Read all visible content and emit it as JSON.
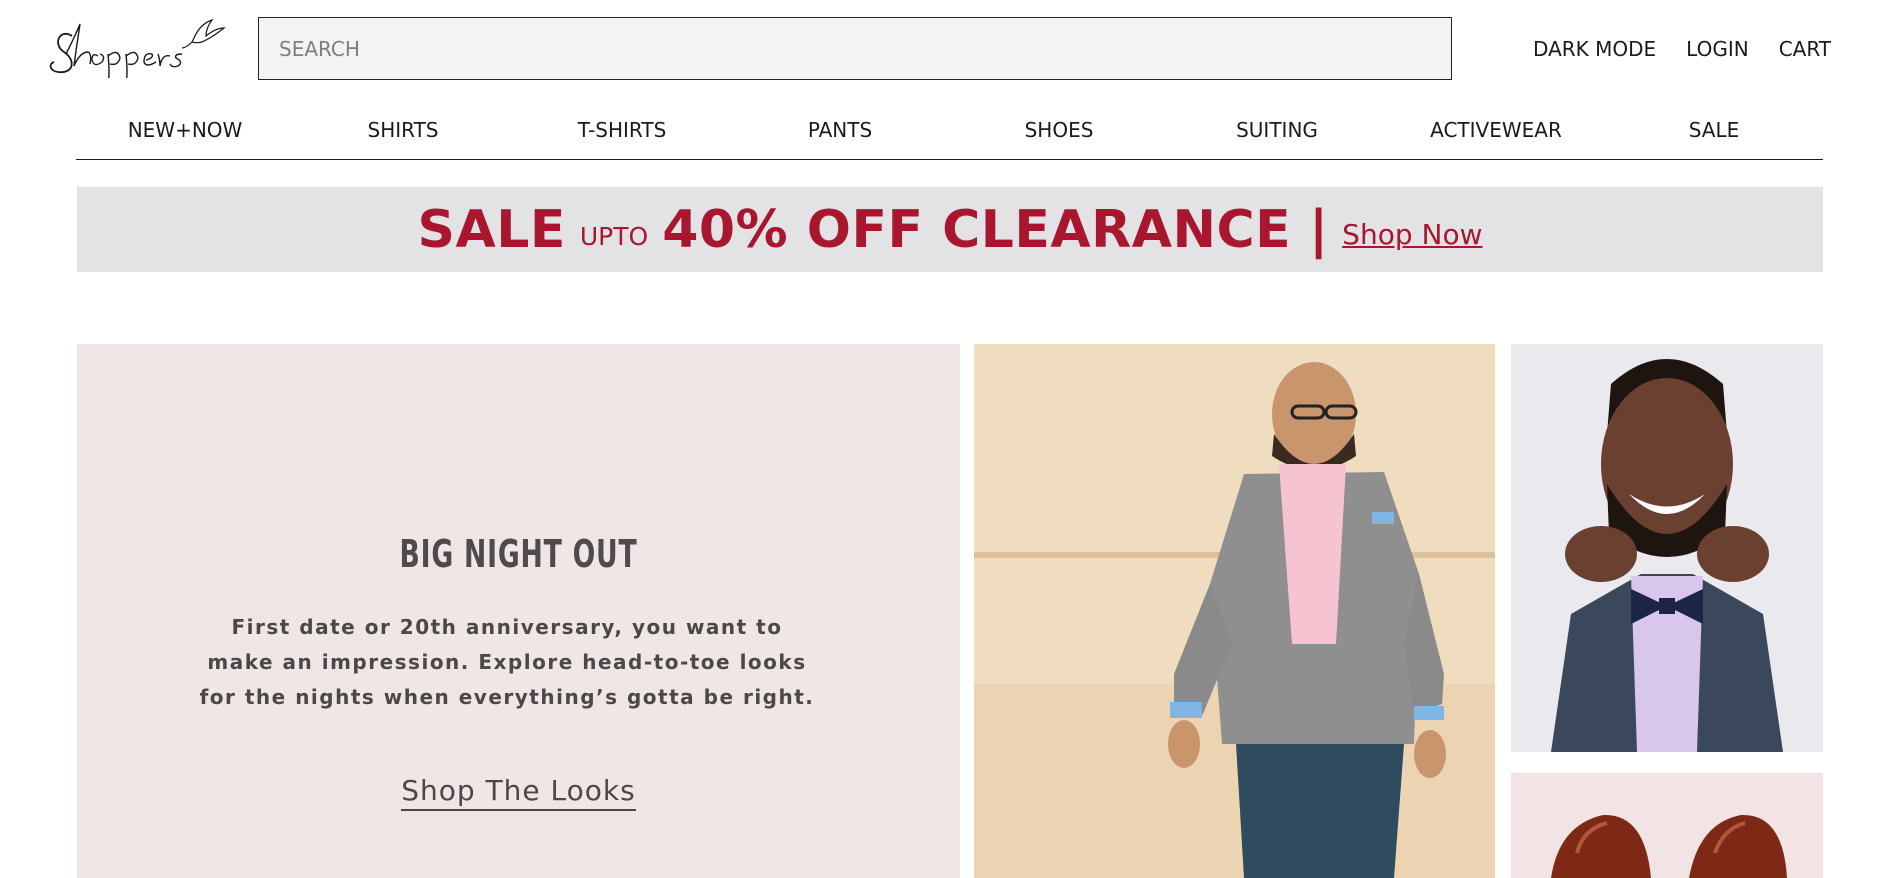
{
  "header": {
    "logo_text": "Shoppers",
    "search_placeholder": "SEARCH",
    "links": [
      "DARK MODE",
      "LOGIN",
      "CART"
    ]
  },
  "nav": {
    "items": [
      "NEW+NOW",
      "SHIRTS",
      "T-SHIRTS",
      "PANTS",
      "SHOES",
      "SUITING",
      "ACTIVEWEAR",
      "SALE"
    ]
  },
  "banner": {
    "sale": "SALE",
    "upto": "UPTO",
    "offer": "40% OFF CLEARANCE",
    "separator": "|",
    "cta": "Shop Now",
    "color": "#a8172f"
  },
  "hero": {
    "title": "BIG NIGHT OUT",
    "body": "First date or 20th anniversary, you want to make an impression. Explore head-to-toe looks for the nights when everything’s gotta be right.",
    "cta": "Shop The Looks"
  },
  "photos": {
    "man": "man-in-grey-blazer-photo",
    "bowtie": "man-with-bowtie-photo",
    "shoes": "brown-brogue-shoes-photo"
  }
}
